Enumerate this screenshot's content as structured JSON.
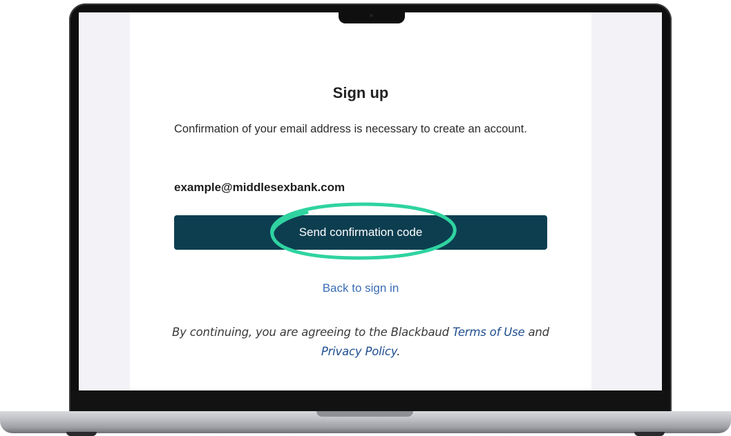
{
  "signup": {
    "title": "Sign up",
    "description": "Confirmation of your email address is necessary to create an account.",
    "email": "example@middlesexbank.com",
    "send_code_label": "Send confirmation code",
    "back_link": "Back to sign in",
    "legal": {
      "prefix": "By continuing, you are agreeing to the Blackbaud",
      "terms_link": "Terms of Use",
      "and": "and",
      "privacy_link": "Privacy Policy",
      "suffix": "."
    }
  },
  "colors": {
    "button_bg": "#0c3e50",
    "link": "#3a6db4",
    "highlight": "#2fd3a0"
  },
  "icons": [
    "camera-notch-icon"
  ]
}
